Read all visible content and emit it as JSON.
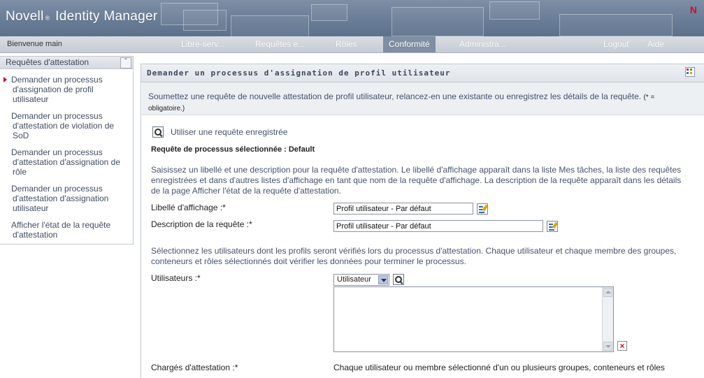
{
  "header": {
    "brand_name": "Novell",
    "brand_reg": "®",
    "brand_product": "Identity Manager",
    "logo_letter": "N",
    "welcome": "Bienvenue main"
  },
  "nav": {
    "tabs": [
      {
        "label": "Libre-serv...",
        "active": false
      },
      {
        "label": "Requêtes e...",
        "active": false
      },
      {
        "label": "Rôles",
        "active": false
      },
      {
        "label": "Conformité",
        "active": true
      },
      {
        "label": "Administra...",
        "active": false
      }
    ],
    "logout": "Logout",
    "help": "Aide"
  },
  "sidebar": {
    "title": "Requêtes d'attestation",
    "items": [
      {
        "line1": "Demander un processus",
        "line2": "d'assignation de profil",
        "line3": "utilisateur",
        "selected": true
      },
      {
        "line1": "Demander un processus",
        "line2": "d'attestation de violation de",
        "line3": "SoD",
        "selected": false
      },
      {
        "line1": "Demander un processus",
        "line2": "d'attestation d'assignation de",
        "line3": "rôle",
        "selected": false
      },
      {
        "line1": "Demander un processus",
        "line2": "d'attestation d'assignation",
        "line3": "utilisateur",
        "selected": false
      },
      {
        "line1": "Afficher l'état de la requête",
        "line2": "d'attestation",
        "line3": "",
        "selected": false
      }
    ]
  },
  "panel": {
    "title": "Demander un processus d'assignation de profil utilisateur",
    "intro": "Soumettez une requête de nouvelle attestation de profil utilisateur, relancez-en une existante ou enregistrez les détails de la requête.",
    "intro_required_a": "(* =",
    "intro_required_b": "obligatoire.)",
    "saved_request_link": "Utiliser une requête enregistrée",
    "selected_process": "Requête de processus sélectionnée : Default",
    "desc_note_1": "Saisissez un libellé et une description pour la requête d'attestation. Le libellé d'affichage apparaît dans la liste Mes tâches, la liste des requêtes",
    "desc_note_2": "enregistrées et dans d'autres listes d'affichage en tant que nom de la requête d'affichage. La description de la requête apparaît dans les détails",
    "desc_note_3": "de la page Afficher l'état de la requête d'attestation.",
    "display_label_label": "Libellé d'affichage :*",
    "display_label_value": "Profil utilisateur - Par défaut",
    "description_label": "Description de la requête :*",
    "description_value": "Profil utilisateur - Par défaut",
    "users_note_1": "Sélectionnez les utilisateurs dont les profils seront vérifiés lors du processus d'attestation. Chaque utilisateur et chaque membre des groupes,",
    "users_note_2": "conteneurs et rôles sélectionnés doit vérifier les données pour terminer le processus.",
    "users_label": "Utilisateurs :*",
    "users_type_selected": "Utilisateur",
    "attesters_label": "Chargés d'attestation :*",
    "attesters_note": "Chaque utilisateur ou membre sélectionné d'un ou plusieurs groupes, conteneurs et rôles"
  },
  "icons": {
    "saved_request": "search-icon",
    "display_label_edit": "edit-icon",
    "description_edit": "edit-icon",
    "users_lookup": "search-icon",
    "remove_user": "delete-icon"
  },
  "colors": {
    "banner": "#6a7d97",
    "active_tab": "#7f8ea2",
    "accent_red": "#c8102e",
    "link_text": "#41506a"
  }
}
